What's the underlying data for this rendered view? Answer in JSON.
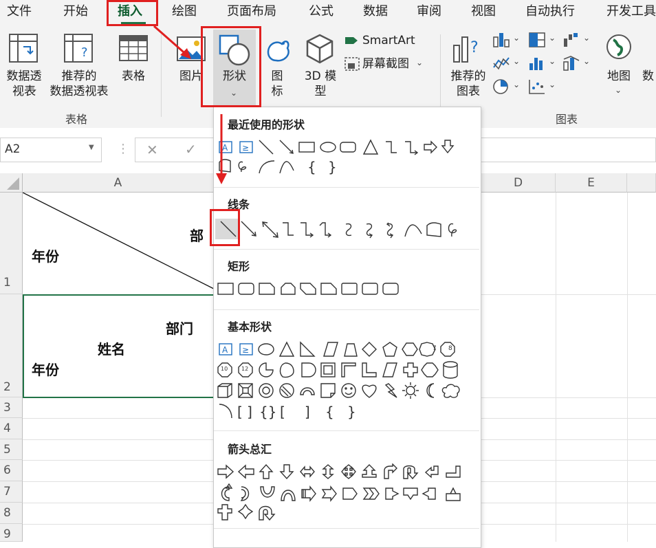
{
  "menu": {
    "tabs": [
      "文件",
      "开始",
      "插入",
      "绘图",
      "页面布局",
      "公式",
      "数据",
      "审阅",
      "视图",
      "自动执行",
      "开发工具"
    ],
    "active_tab": "插入"
  },
  "ribbon": {
    "tables_group": {
      "label": "表格",
      "pivot_table": "数据透\n视表",
      "pivot_dropdown_mark": "⌄",
      "recommended_pivot": "推荐的\n数据透视表",
      "table": "表格"
    },
    "illustrations": {
      "picture": "图片",
      "shapes": "形状",
      "icons": "图\n标",
      "model_3d": "3D 模\n型",
      "smartart": "SmartArt",
      "screenshot": "屏幕截图"
    },
    "charts_group": {
      "label": "图表",
      "recommended_charts": "推荐的\n图表",
      "map": "地图",
      "pivot_chart_partial": "数"
    }
  },
  "formula_bar": {
    "name_box": "A2",
    "cancel_symbol": "✕",
    "enter_symbol": "✓"
  },
  "grid": {
    "columns": [
      "A",
      "D",
      "E"
    ],
    "rows": [
      "1",
      "2",
      "3",
      "4",
      "5",
      "6",
      "7",
      "8",
      "9"
    ],
    "cell_a1": {
      "top_right": "部",
      "bottom_left": "年份"
    },
    "cell_a2": {
      "top_right": "部门",
      "middle": "姓名",
      "bottom_left": "年份"
    }
  },
  "shapes_menu": {
    "recent_title": "最近使用的形状",
    "lines_title": "线条",
    "rectangles_title": "矩形",
    "basic_title": "基本形状",
    "arrows_title": "箭头总汇",
    "basic_numbers": [
      "7",
      "8",
      "10",
      "12"
    ]
  },
  "colors": {
    "accent_green": "#217346",
    "highlight_red": "#e02020",
    "selection_gray": "#d9d9d9"
  }
}
